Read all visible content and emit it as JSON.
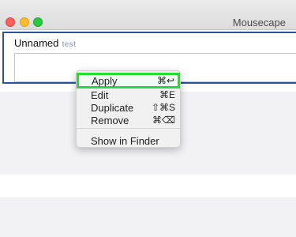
{
  "window": {
    "title": "Mousecape"
  },
  "cape": {
    "name": "Unnamed",
    "author": "test"
  },
  "context_menu": {
    "items": [
      {
        "label": "Apply",
        "shortcut": "⌘↩"
      },
      {
        "label": "Edit",
        "shortcut": "⌘E"
      },
      {
        "label": "Duplicate",
        "shortcut": "⇧⌘S"
      },
      {
        "label": "Remove",
        "shortcut": "⌘⌫"
      },
      {
        "label": "Show in Finder",
        "shortcut": ""
      }
    ]
  },
  "colors": {
    "highlight_border": "#22dd33",
    "selection_border": "#2e4fa6"
  }
}
